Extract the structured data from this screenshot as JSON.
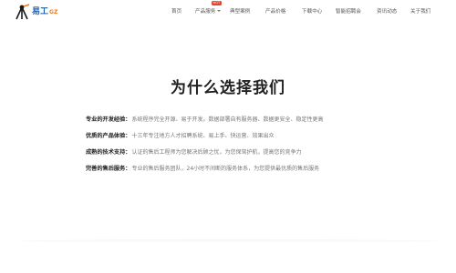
{
  "header": {
    "logo": {
      "text": "易工",
      "sub": "GZ",
      "icon": "tripod-logo-icon"
    },
    "nav": [
      {
        "label": "首页",
        "has_caret": false
      },
      {
        "label": "产品服务",
        "has_caret": true,
        "badge": "HOT"
      },
      {
        "label": "典型案例",
        "has_caret": false
      },
      {
        "label": "产品价格",
        "has_caret": false
      },
      {
        "label": "下载中心",
        "has_caret": false
      },
      {
        "label": "智能招聘会",
        "has_caret": false
      },
      {
        "label": "资讯动态",
        "has_caret": false
      },
      {
        "label": "关于我们",
        "has_caret": false
      }
    ]
  },
  "main": {
    "title": "为什么选择我们",
    "features": [
      {
        "label": "专业的开发经验：",
        "desc": "系统程序完全开源、易于开发。数据部署自有服务器、数据更安全、稳定性更高"
      },
      {
        "label": "优质的产品体验：",
        "desc": "十三年专注地方人才招聘系统、易上手、快运营、效果出众"
      },
      {
        "label": "成熟的技术支持：",
        "desc": "认证的售后工程师为您解决后顾之忧，为您保驾护航，提高您的竞争力"
      },
      {
        "label": "完善的售后服务：",
        "desc": "专业的售后服务团队，24小时不间断的服务体系，为您提供最优质的售后服务"
      }
    ]
  },
  "colors": {
    "accent": "#1f5fa8",
    "logo_orange": "#f07a1e",
    "badge": "#e8432f"
  }
}
